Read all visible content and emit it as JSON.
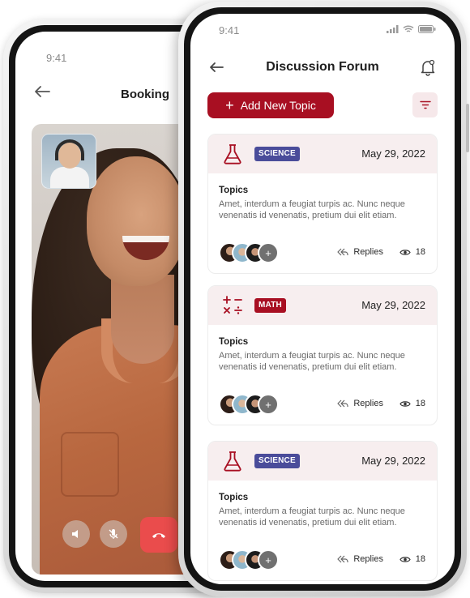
{
  "back_phone": {
    "status_time": "9:41",
    "title": "Booking"
  },
  "front_phone": {
    "status_time": "9:41",
    "header": {
      "title": "Discussion Forum"
    },
    "add_button_label": "Add New Topic",
    "topics": [
      {
        "subject": "SCIENCE",
        "subject_icon": "flask-icon",
        "badge_color": "#4a4c9a",
        "date": "May 29, 2022",
        "title": "Topics",
        "text": "Amet, interdum a feugiat turpis ac. Nunc neque venenatis id venenatis, pretium dui elit etiam.",
        "replies_label": "Replies",
        "views": "18"
      },
      {
        "subject": "MATH",
        "subject_icon": "math-symbols-icon",
        "badge_color": "#a80f22",
        "date": "May 29, 2022",
        "title": "Topics",
        "text": "Amet, interdum a feugiat turpis ac. Nunc neque venenatis id venenatis, pretium dui elit etiam.",
        "replies_label": "Replies",
        "views": "18"
      },
      {
        "subject": "SCIENCE",
        "subject_icon": "flask-icon",
        "badge_color": "#4a4c9a",
        "date": "May 29, 2022",
        "title": "Topics",
        "text": "Amet, interdum a feugiat turpis ac. Nunc neque venenatis id venenatis, pretium dui elit etiam.",
        "replies_label": "Replies",
        "views": "18"
      }
    ]
  },
  "colors": {
    "accent": "#a80f22",
    "card_header": "#f7eeef",
    "science_badge": "#4a4c9a",
    "end_call": "#ea4c4c"
  }
}
